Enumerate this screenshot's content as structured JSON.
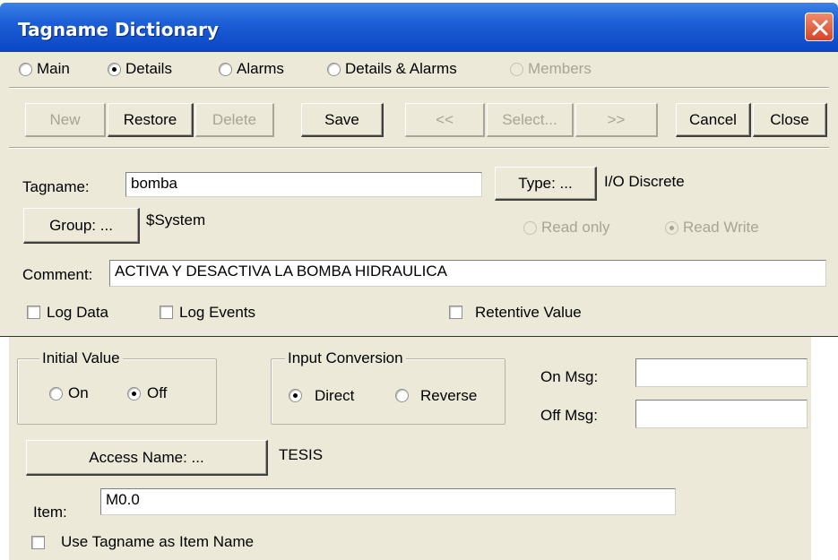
{
  "window": {
    "title": "Tagname Dictionary"
  },
  "colors": {
    "titlebar": "#0a46c4",
    "panel": "#ece9d8",
    "close": "#d5452a"
  },
  "view_tabs": [
    {
      "label": "Main",
      "checked": false,
      "disabled": false
    },
    {
      "label": "Details",
      "checked": true,
      "disabled": false
    },
    {
      "label": "Alarms",
      "checked": false,
      "disabled": false
    },
    {
      "label": "Details & Alarms",
      "checked": false,
      "disabled": false
    },
    {
      "label": "Members",
      "checked": false,
      "disabled": true
    }
  ],
  "toolbar": {
    "new": "New",
    "restore": "Restore",
    "delete": "Delete",
    "save": "Save",
    "prev": "<<",
    "select": "Select...",
    "next": ">>",
    "cancel": "Cancel",
    "close": "Close"
  },
  "tag": {
    "tagname_label": "Tagname:",
    "tagname_value": "bomba",
    "type_button": "Type: ...",
    "type_value": "I/O Discrete",
    "group_button": "Group: ...",
    "group_value": "$System",
    "read_only": "Read only",
    "read_write": "Read Write",
    "comment_label": "Comment:",
    "comment_value": "ACTIVA Y DESACTIVA LA BOMBA HIDRAULICA",
    "log_data": "Log Data",
    "log_events": "Log Events",
    "retentive_value": "Retentive Value"
  },
  "details": {
    "initial_value_legend": "Initial Value",
    "on": "On",
    "off": "Off",
    "input_conversion_legend": "Input Conversion",
    "direct": "Direct",
    "reverse": "Reverse",
    "on_msg_label": "On Msg:",
    "on_msg_value": "",
    "off_msg_label": "Off Msg:",
    "off_msg_value": "",
    "access_name_button": "Access Name: ...",
    "access_name_value": "TESIS",
    "item_label": "Item:",
    "item_value": "M0.0",
    "use_tagname": "Use Tagname as Item Name"
  }
}
